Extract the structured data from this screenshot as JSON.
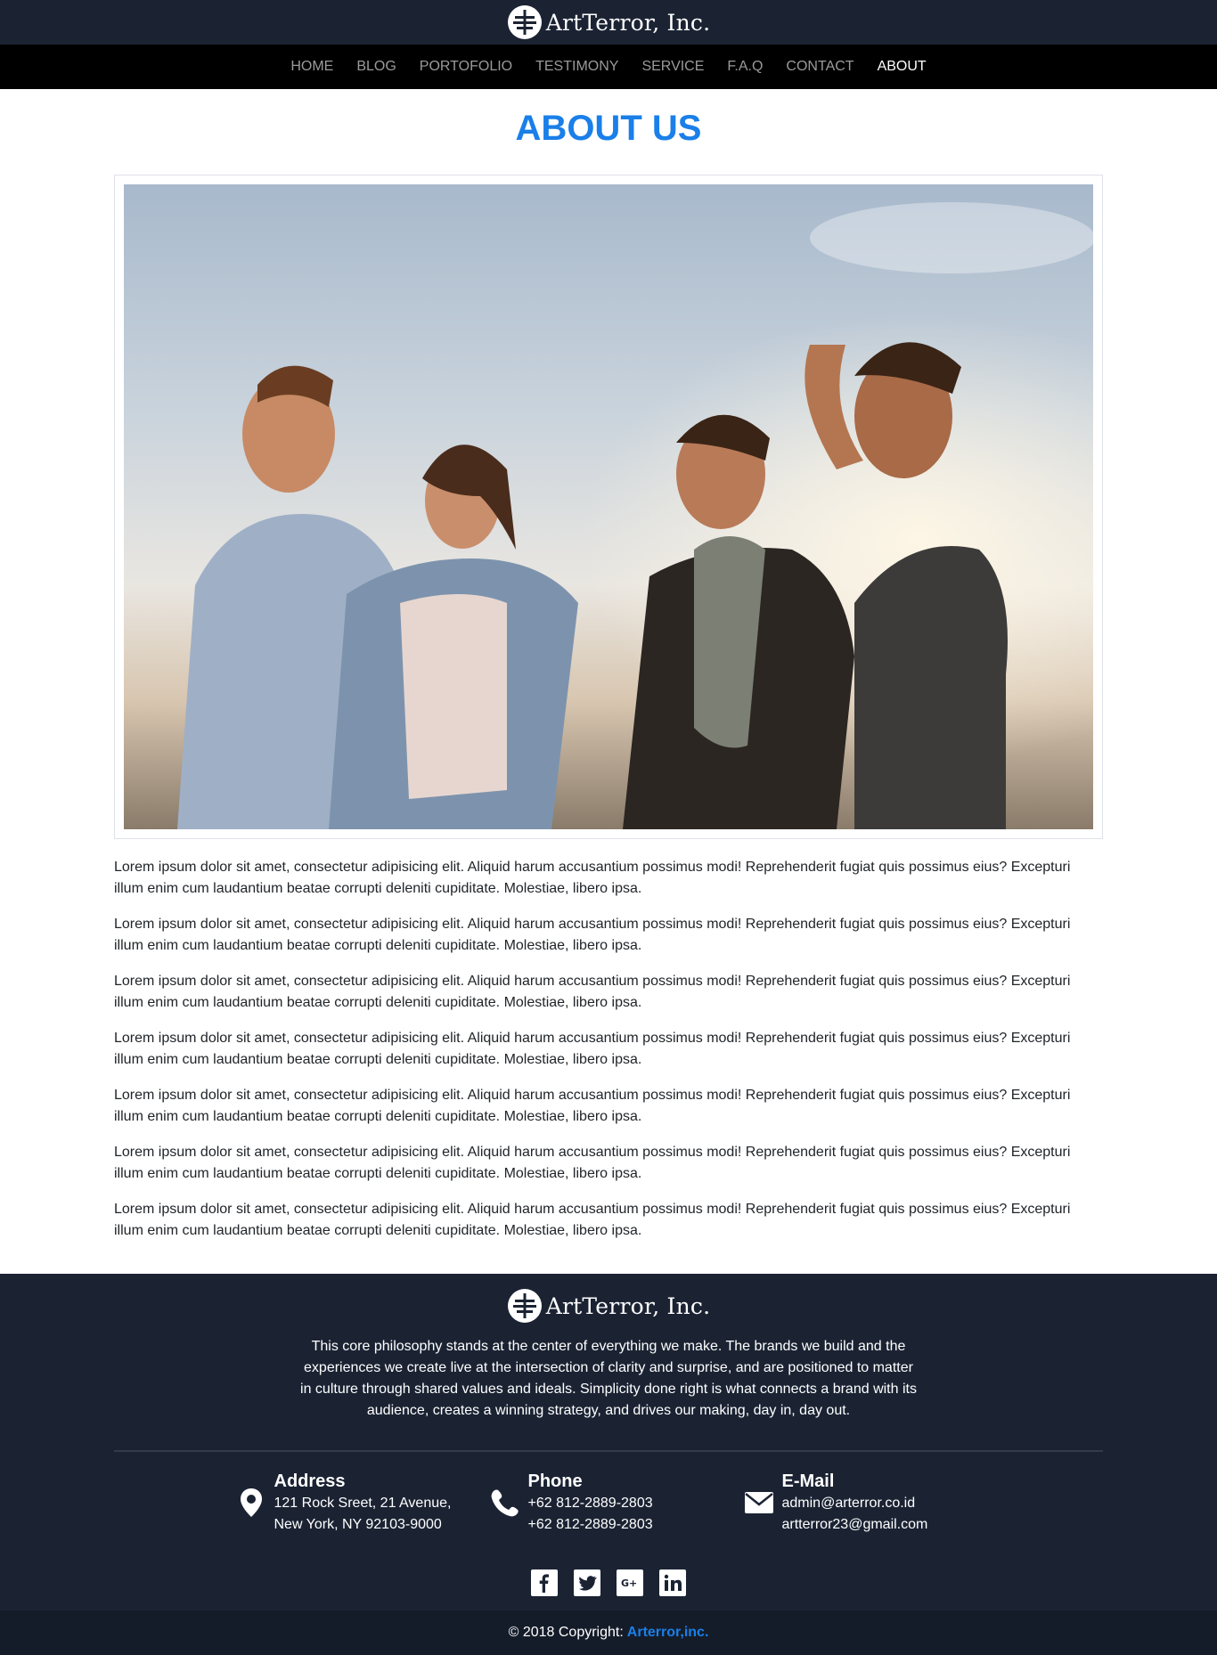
{
  "brand": {
    "name": "ArtTerror, Inc."
  },
  "nav": {
    "items": [
      {
        "label": "HOME",
        "active": false
      },
      {
        "label": "BLOG",
        "active": false
      },
      {
        "label": "PORTOFOLIO",
        "active": false
      },
      {
        "label": "TESTIMONY",
        "active": false
      },
      {
        "label": "SERVICE",
        "active": false
      },
      {
        "label": "F.A.Q",
        "active": false
      },
      {
        "label": "CONTACT",
        "active": false
      },
      {
        "label": "ABOUT",
        "active": true
      }
    ]
  },
  "page": {
    "title": "ABOUT US",
    "paragraphs": [
      "Lorem ipsum dolor sit amet, consectetur adipisicing elit. Aliquid harum accusantium possimus modi! Reprehenderit fugiat quis possimus eius? Excepturi illum enim cum laudantium beatae corrupti deleniti cupiditate. Molestiae, libero ipsa.",
      "Lorem ipsum dolor sit amet, consectetur adipisicing elit. Aliquid harum accusantium possimus modi! Reprehenderit fugiat quis possimus eius? Excepturi illum enim cum laudantium beatae corrupti deleniti cupiditate. Molestiae, libero ipsa.",
      "Lorem ipsum dolor sit amet, consectetur adipisicing elit. Aliquid harum accusantium possimus modi! Reprehenderit fugiat quis possimus eius? Excepturi illum enim cum laudantium beatae corrupti deleniti cupiditate. Molestiae, libero ipsa.",
      "Lorem ipsum dolor sit amet, consectetur adipisicing elit. Aliquid harum accusantium possimus modi! Reprehenderit fugiat quis possimus eius? Excepturi illum enim cum laudantium beatae corrupti deleniti cupiditate. Molestiae, libero ipsa.",
      "Lorem ipsum dolor sit amet, consectetur adipisicing elit. Aliquid harum accusantium possimus modi! Reprehenderit fugiat quis possimus eius? Excepturi illum enim cum laudantium beatae corrupti deleniti cupiditate. Molestiae, libero ipsa.",
      "Lorem ipsum dolor sit amet, consectetur adipisicing elit. Aliquid harum accusantium possimus modi! Reprehenderit fugiat quis possimus eius? Excepturi illum enim cum laudantium beatae corrupti deleniti cupiditate. Molestiae, libero ipsa.",
      "Lorem ipsum dolor sit amet, consectetur adipisicing elit. Aliquid harum accusantium possimus modi! Reprehenderit fugiat quis possimus eius? Excepturi illum enim cum laudantium beatae corrupti deleniti cupiditate. Molestiae, libero ipsa."
    ]
  },
  "footer": {
    "brand": "ArtTerror, Inc.",
    "description": "This core philosophy stands at the center of everything we make. The brands we build and the experiences we create live at the intersection of clarity and surprise, and are positioned to matter in culture through shared values and ideals. Simplicity done right is what connects a brand with its audience, creates a winning strategy, and drives our making, day in, day out.",
    "contacts": [
      {
        "icon": "map-pin-icon",
        "title": "Address",
        "lines": [
          "121 Rock Sreet, 21 Avenue,",
          "New York, NY 92103-9000"
        ]
      },
      {
        "icon": "phone-icon",
        "title": "Phone",
        "lines": [
          "+62 812-2889-2803",
          "+62 812-2889-2803"
        ]
      },
      {
        "icon": "envelope-icon",
        "title": "E-Mail",
        "lines": [
          "admin@arterror.co.id",
          "artterror23@gmail.com"
        ]
      }
    ],
    "socials": [
      "facebook-icon",
      "twitter-icon",
      "google-plus-icon",
      "linkedin-icon"
    ],
    "copyright_prefix": "© 2018 Copyright:",
    "copyright_link": "Arterror,inc."
  },
  "colors": {
    "accent": "#1a7fe8",
    "header_bg": "#1b2333",
    "nav_bg": "#000000",
    "footer_bottom_bg": "#151c29"
  }
}
